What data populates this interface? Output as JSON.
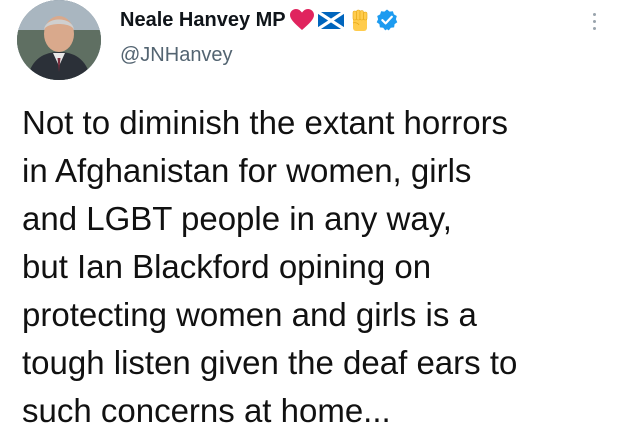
{
  "tweet": {
    "author": {
      "display_name": "Neale Hanvey MP",
      "handle": "@JNHanvey",
      "emojis": [
        "red-heart-icon",
        "scotland-saltire-flag-icon",
        "raised-fist-icon"
      ],
      "verified": true
    },
    "text_lines": [
      "Not to diminish the extant horrors",
      "in Afghanistan for women, girls",
      "and LGBT people in any way,",
      "but Ian Blackford opining on",
      "protecting women and girls is a",
      "tough listen given the deaf ears to",
      "such concerns at home..."
    ],
    "more_menu_icon": "more-vertical-icon"
  },
  "colors": {
    "text": "#0f1419",
    "secondary_text": "#536471",
    "verified_blue": "#1d9bf0",
    "heart_red": "#e0245e",
    "saltire_blue": "#0065bd",
    "fist_yellow": "#ffcc4d"
  }
}
